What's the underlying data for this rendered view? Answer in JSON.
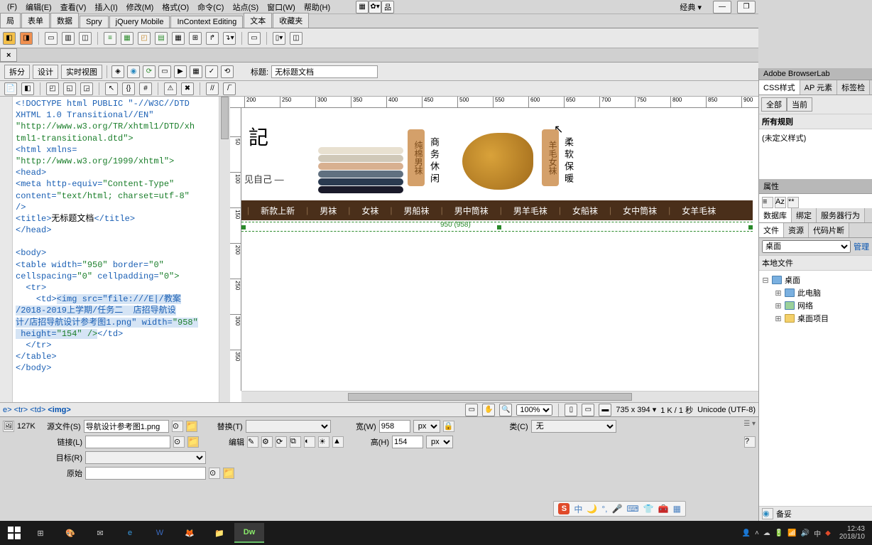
{
  "menubar": {
    "file": "(F)",
    "edit": "编辑(E)",
    "view": "查看(V)",
    "insert": "插入(I)",
    "modify": "修改(M)",
    "format": "格式(O)",
    "commands": "命令(C)",
    "site": "站点(S)",
    "window": "窗口(W)",
    "help": "帮助(H)",
    "layout": "经典"
  },
  "insert_tabs": [
    "局",
    "表单",
    "数据",
    "Spry",
    "jQuery Mobile",
    "InContext Editing",
    "文本",
    "收藏夹"
  ],
  "doc_toolbar": {
    "split": "拆分",
    "design": "设计",
    "live": "实时视图",
    "title_label": "标题:",
    "title_value": "无标题文档"
  },
  "code_text": {
    "l1": "<!DOCTYPE html PUBLIC \"-//W3C//DTD",
    "l2": "XHTML 1.0 Transitional//EN\"",
    "l3": "\"http://www.w3.org/TR/xhtml1/DTD/xh",
    "l4": "tml1-transitional.dtd\">",
    "l5": "<html xmlns=",
    "l6": "\"http://www.w3.org/1999/xhtml\">",
    "l7": "<head>",
    "l8a": "<meta http-equiv=",
    "l8b": "\"Content-Type\"",
    "l9a": "content=",
    "l9b": "\"text/html; charset=utf-8\"",
    "l10": "/>",
    "l11a": "<title>",
    "l11b": "无标题文档",
    "l11c": "</title>",
    "l12": "</head>",
    "l13": "<body>",
    "l14a": "<table width=",
    "l14b": "\"950\"",
    "l14c": " border=",
    "l14d": "\"0\"",
    "l15a": "cellspacing=",
    "l15b": "\"0\"",
    "l15c": " cellpadding=",
    "l15d": "\"0\">",
    "l16": "  <tr>",
    "l17a": "    <td>",
    "l17b": "<img src=\"file:///E|/教案",
    "l18": "/2018-2019上学期/任务二  店招导航设",
    "l19a": "计/店招导航设计参考图1.png\" width=",
    "l19b": "\"958\"",
    "l20a": " height=",
    "l20b": "\"154\" />",
    "l20c": "</td>",
    "l21": "  </tr>",
    "l22": "</table>",
    "l23": "</body>"
  },
  "banner": {
    "logo": "記",
    "slogan": "见自己 —",
    "tag1": "纯棉男袜",
    "text1": "商务休闲",
    "tag2": "羊毛女袜",
    "text2": "柔软保暖"
  },
  "navbar_items": [
    "新款上新",
    "男袜",
    "女袜",
    "男船袜",
    "男中筒袜",
    "男羊毛袜",
    "女船袜",
    "女中筒袜",
    "女羊毛袜"
  ],
  "sel_marker": "950 (958)",
  "tag_selector": {
    "a": "e>",
    "b": "<tr>",
    "c": "<td>",
    "d": "<img>"
  },
  "status": {
    "zoom": "100%",
    "dims": "735 x 394",
    "size": "1 K / 1 秒",
    "enc": "Unicode (UTF-8)"
  },
  "props": {
    "size": "127K",
    "src_label": "源文件(S)",
    "src_value": "导航设计参考图1.png",
    "replace_label": "替换(T)",
    "width_label": "宽(W)",
    "width_value": "958",
    "px": "px",
    "class_label": "类(C)",
    "class_value": "无",
    "link_label": "链接(L)",
    "edit_label": "编辑",
    "height_label": "高(H)",
    "height_value": "154",
    "target_label": "目标(R)",
    "orig_label": "原始"
  },
  "right": {
    "browserlab": "Adobe BrowserLab",
    "css_tabs": [
      "CSS样式",
      "AP 元素",
      "标签检"
    ],
    "css_btns": [
      "全部",
      "当前"
    ],
    "all_rules": "所有规则",
    "no_style": "(未定义样式)",
    "attrs": "属性",
    "tabs2": [
      "数据库",
      "绑定",
      "服务器行为"
    ],
    "tabs3": [
      "文件",
      "资源",
      "代码片断"
    ],
    "site_select": "桌面",
    "manage": "管理",
    "local_files": "本地文件",
    "tree": {
      "desktop": "桌面",
      "pc": "此电脑",
      "network": "网络",
      "items": "桌面项目"
    },
    "log": "备妥"
  },
  "ime": {
    "zhong": "中"
  },
  "taskbar": {
    "time": "12:43",
    "date": "2018/10"
  }
}
